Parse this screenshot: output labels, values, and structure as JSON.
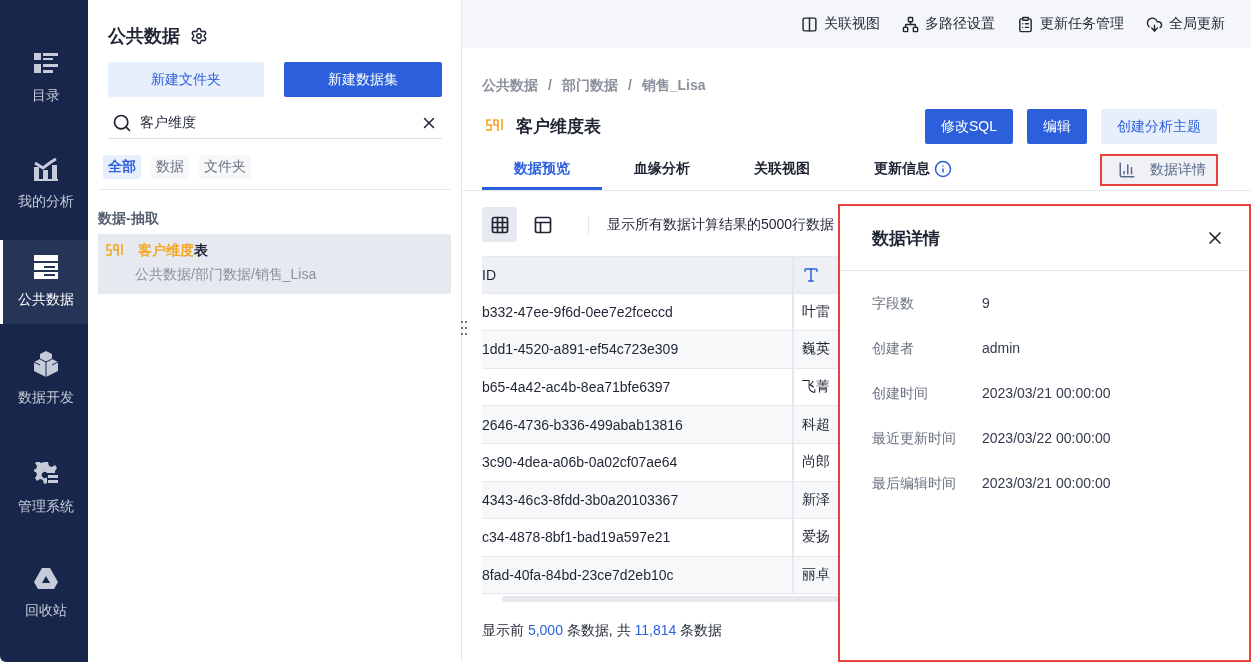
{
  "nav": [
    {
      "label": "目录",
      "selected": false
    },
    {
      "label": "我的分析",
      "selected": false
    },
    {
      "label": "公共数据",
      "selected": true
    },
    {
      "label": "数据开发",
      "selected": false
    },
    {
      "label": "管理系统",
      "selected": false
    },
    {
      "label": "回收站",
      "selected": false
    }
  ],
  "panel": {
    "title": "公共数据",
    "buttons": [
      {
        "label": "新建文件夹",
        "kind": "secondary"
      },
      {
        "label": "新建数据集",
        "kind": "primary"
      }
    ],
    "search": {
      "value": "客户维度"
    },
    "filters": [
      {
        "label": "全部",
        "selected": true
      },
      {
        "label": "数据",
        "selected": false
      },
      {
        "label": "文件夹",
        "selected": false
      }
    ],
    "group": "数据-抽取",
    "results": [
      {
        "match": "客户维度",
        "rest": "表",
        "path": "公共数据/部门数据/销售_Lisa",
        "selected": true
      }
    ]
  },
  "topbar": [
    "关联视图",
    "多路径设置",
    "更新任务管理",
    "全局更新"
  ],
  "breadcrumb": {
    "items": [
      "公共数据",
      "部门数据",
      "销售_Lisa"
    ],
    "separators": [
      "/",
      "/"
    ]
  },
  "dataset": {
    "title": "客户维度表"
  },
  "actions": [
    {
      "label": "修改SQL",
      "kind": "primary"
    },
    {
      "label": "编辑",
      "kind": "primary"
    },
    {
      "label": "创建分析主题",
      "kind": "secondary"
    }
  ],
  "tabs": [
    {
      "label": "数据预览",
      "selected": true,
      "info": false
    },
    {
      "label": "血缘分析",
      "selected": false,
      "info": false
    },
    {
      "label": "关联视图",
      "selected": false,
      "info": false
    },
    {
      "label": "更新信息",
      "selected": false,
      "info": true
    }
  ],
  "details_button": "数据详情",
  "toolbar": {
    "views": [
      {
        "selected": true
      },
      {
        "selected": false
      }
    ],
    "note": "显示所有数据计算结果的5000行数据"
  },
  "table": {
    "columns": [
      {
        "label": "ID"
      },
      {}
    ],
    "rows": [
      [
        "b332-47ee-9f6d-0ee7e2fceccd",
        "叶雷"
      ],
      [
        "1dd1-4520-a891-ef54c723e309",
        "巍英"
      ],
      [
        "b65-4a42-ac4b-8ea71bfe6397",
        "飞菁"
      ],
      [
        "2646-4736-b336-499abab13816",
        "科超"
      ],
      [
        "3c90-4dea-a06b-0a02cf07ae64",
        "尚郎"
      ],
      [
        "4343-46c3-8fdd-3b0a20103367",
        "新泽"
      ],
      [
        "c34-4878-8bf1-bad19a597e21",
        "爱扬"
      ],
      [
        "8fad-40fa-84bd-23ce7d2eb10c",
        "丽卓"
      ]
    ]
  },
  "footer": {
    "prefix": "显示前 ",
    "shown": "5,000",
    "middle": " 条数据, 共 ",
    "total": "11,814",
    "suffix": " 条数据"
  },
  "drawer": {
    "title": "数据详情",
    "fields": [
      {
        "label": "字段数",
        "value": "9"
      },
      {
        "label": "创建者",
        "value": "admin"
      },
      {
        "label": "创建时间",
        "value": "2023/03/21 00:00:00"
      },
      {
        "label": "最近更新时间",
        "value": "2023/03/22 00:00:00"
      },
      {
        "label": "最后编辑时间",
        "value": "2023/03/21 00:00:00"
      }
    ]
  }
}
